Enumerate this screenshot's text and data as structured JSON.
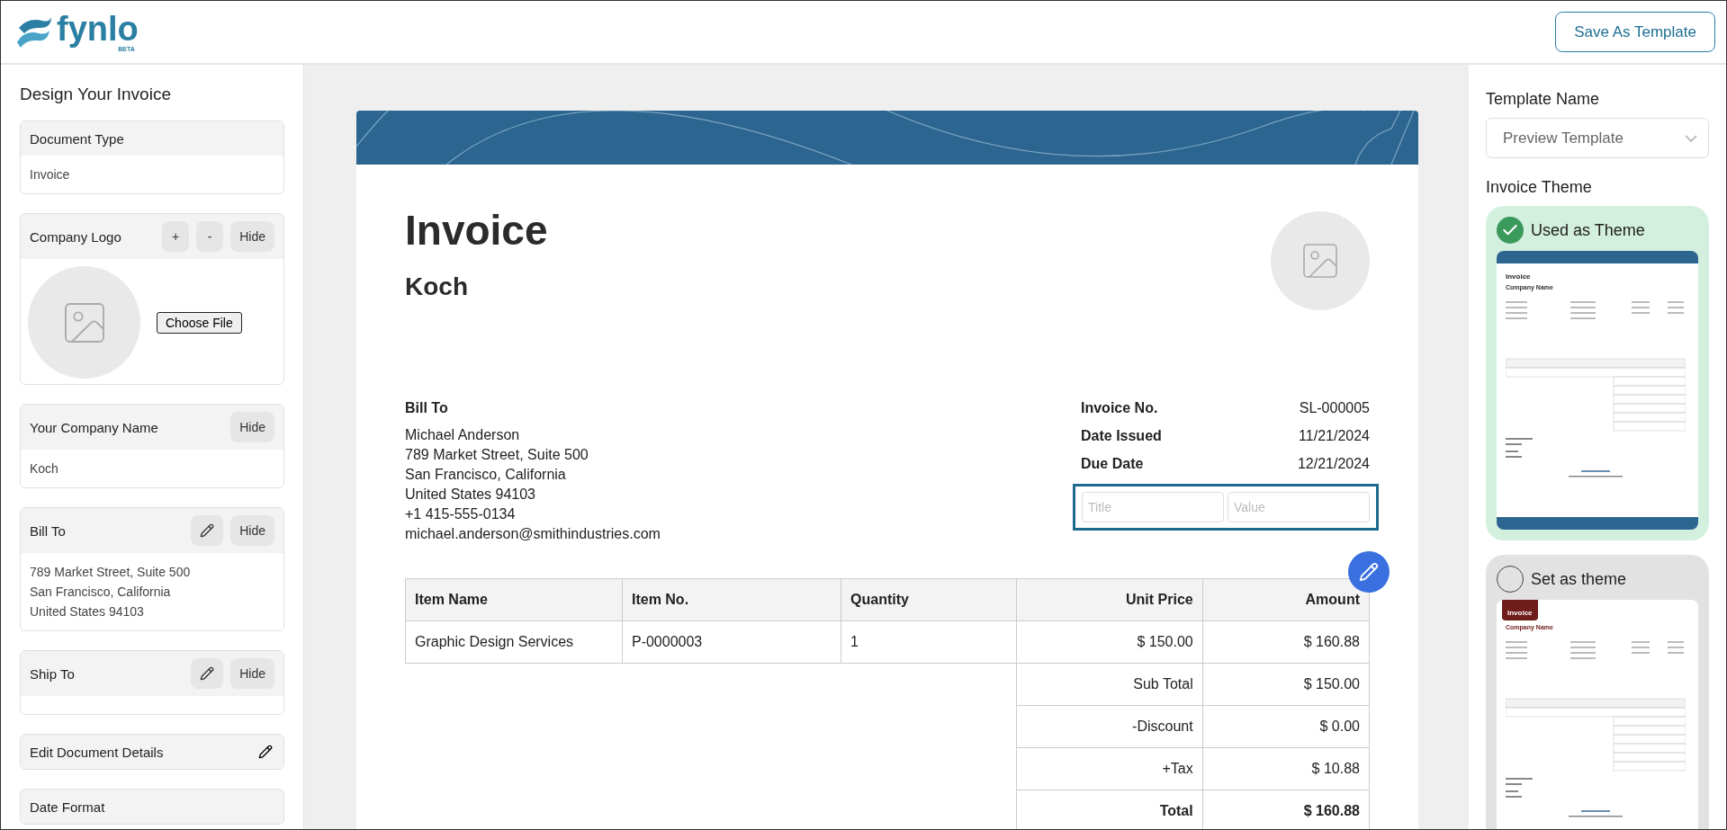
{
  "header": {
    "logo": {
      "name": "fynlo",
      "badge": "BETA"
    },
    "save_button": "Save As Template"
  },
  "sidebar": {
    "title": "Design Your Invoice",
    "sections": [
      {
        "kind": "text",
        "title": "Document Type",
        "value": "Invoice"
      },
      {
        "kind": "logo",
        "title": "Company Logo",
        "button": "Choose File",
        "actions": [
          {
            "kind": "text",
            "label": "+"
          },
          {
            "kind": "text",
            "label": "-"
          },
          {
            "kind": "text",
            "label": "Hide"
          }
        ]
      },
      {
        "kind": "text",
        "title": "Your Company Name",
        "value": "Koch",
        "actions": [
          {
            "kind": "text",
            "label": "Hide"
          }
        ]
      },
      {
        "kind": "address",
        "title": "Bill To",
        "lines": [
          "789 Market Street, Suite 500",
          "San Francisco, California",
          "United States 94103"
        ],
        "actions": [
          {
            "kind": "pencil"
          },
          {
            "kind": "text",
            "label": "Hide"
          }
        ]
      },
      {
        "kind": "address",
        "title": "Ship To",
        "actions": [
          {
            "kind": "pencil"
          },
          {
            "kind": "text",
            "label": "Hide"
          }
        ]
      },
      {
        "kind": "link",
        "title": "Edit Document Details",
        "actions": [
          {
            "kind": "bare-pencil"
          }
        ]
      },
      {
        "kind": "link",
        "title": "Date Format"
      }
    ]
  },
  "invoice": {
    "title": "Invoice",
    "company": "Koch",
    "bill_to": {
      "heading": "Bill To",
      "lines": [
        "Michael Anderson",
        "789 Market Street, Suite 500",
        "San Francisco, California",
        "United States 94103",
        "+1 415-555-0134",
        "michael.anderson@smithindustries.com"
      ]
    },
    "meta": [
      {
        "label": "Invoice No.",
        "value": "SL-000005"
      },
      {
        "label": "Date Issued",
        "value": "11/21/2024"
      },
      {
        "label": "Due Date",
        "value": "12/21/2024"
      }
    ],
    "custom_field": {
      "title_placeholder": "Title",
      "value_placeholder": "Value"
    },
    "table": {
      "columns": [
        {
          "label": "Item Name",
          "kind": "text"
        },
        {
          "label": "Item No.",
          "kind": "text"
        },
        {
          "label": "Quantity",
          "kind": "text"
        },
        {
          "label": "Unit Price",
          "kind": "amount"
        },
        {
          "label": "Amount",
          "kind": "amount"
        }
      ],
      "rows": [
        [
          "Graphic Design Services",
          "P-0000003",
          "1",
          "$ 150.00",
          "$ 160.88"
        ]
      ]
    },
    "totals": [
      {
        "label": "Sub Total",
        "value": "$ 150.00",
        "bold": false
      },
      {
        "label": "-Discount",
        "value": "$ 0.00",
        "bold": false
      },
      {
        "label": "+Tax",
        "value": "$ 10.88",
        "bold": false
      },
      {
        "label": "Total",
        "value": "$ 160.88",
        "bold": true
      }
    ]
  },
  "right_panel": {
    "template_label": "Template Name",
    "template_select": "Preview Template",
    "themes_title": "Invoice Theme",
    "themes": [
      {
        "label": "Used as Theme",
        "selected": true,
        "kind": "banner",
        "color": "#2c6690",
        "preview_title": "Invoice",
        "preview_subtitle": "Company Name"
      },
      {
        "label": "Set as theme",
        "selected": false,
        "kind": "block",
        "color": "#6e1d1a",
        "preview_title": "Invoice",
        "preview_subtitle": "Company Name"
      }
    ]
  }
}
